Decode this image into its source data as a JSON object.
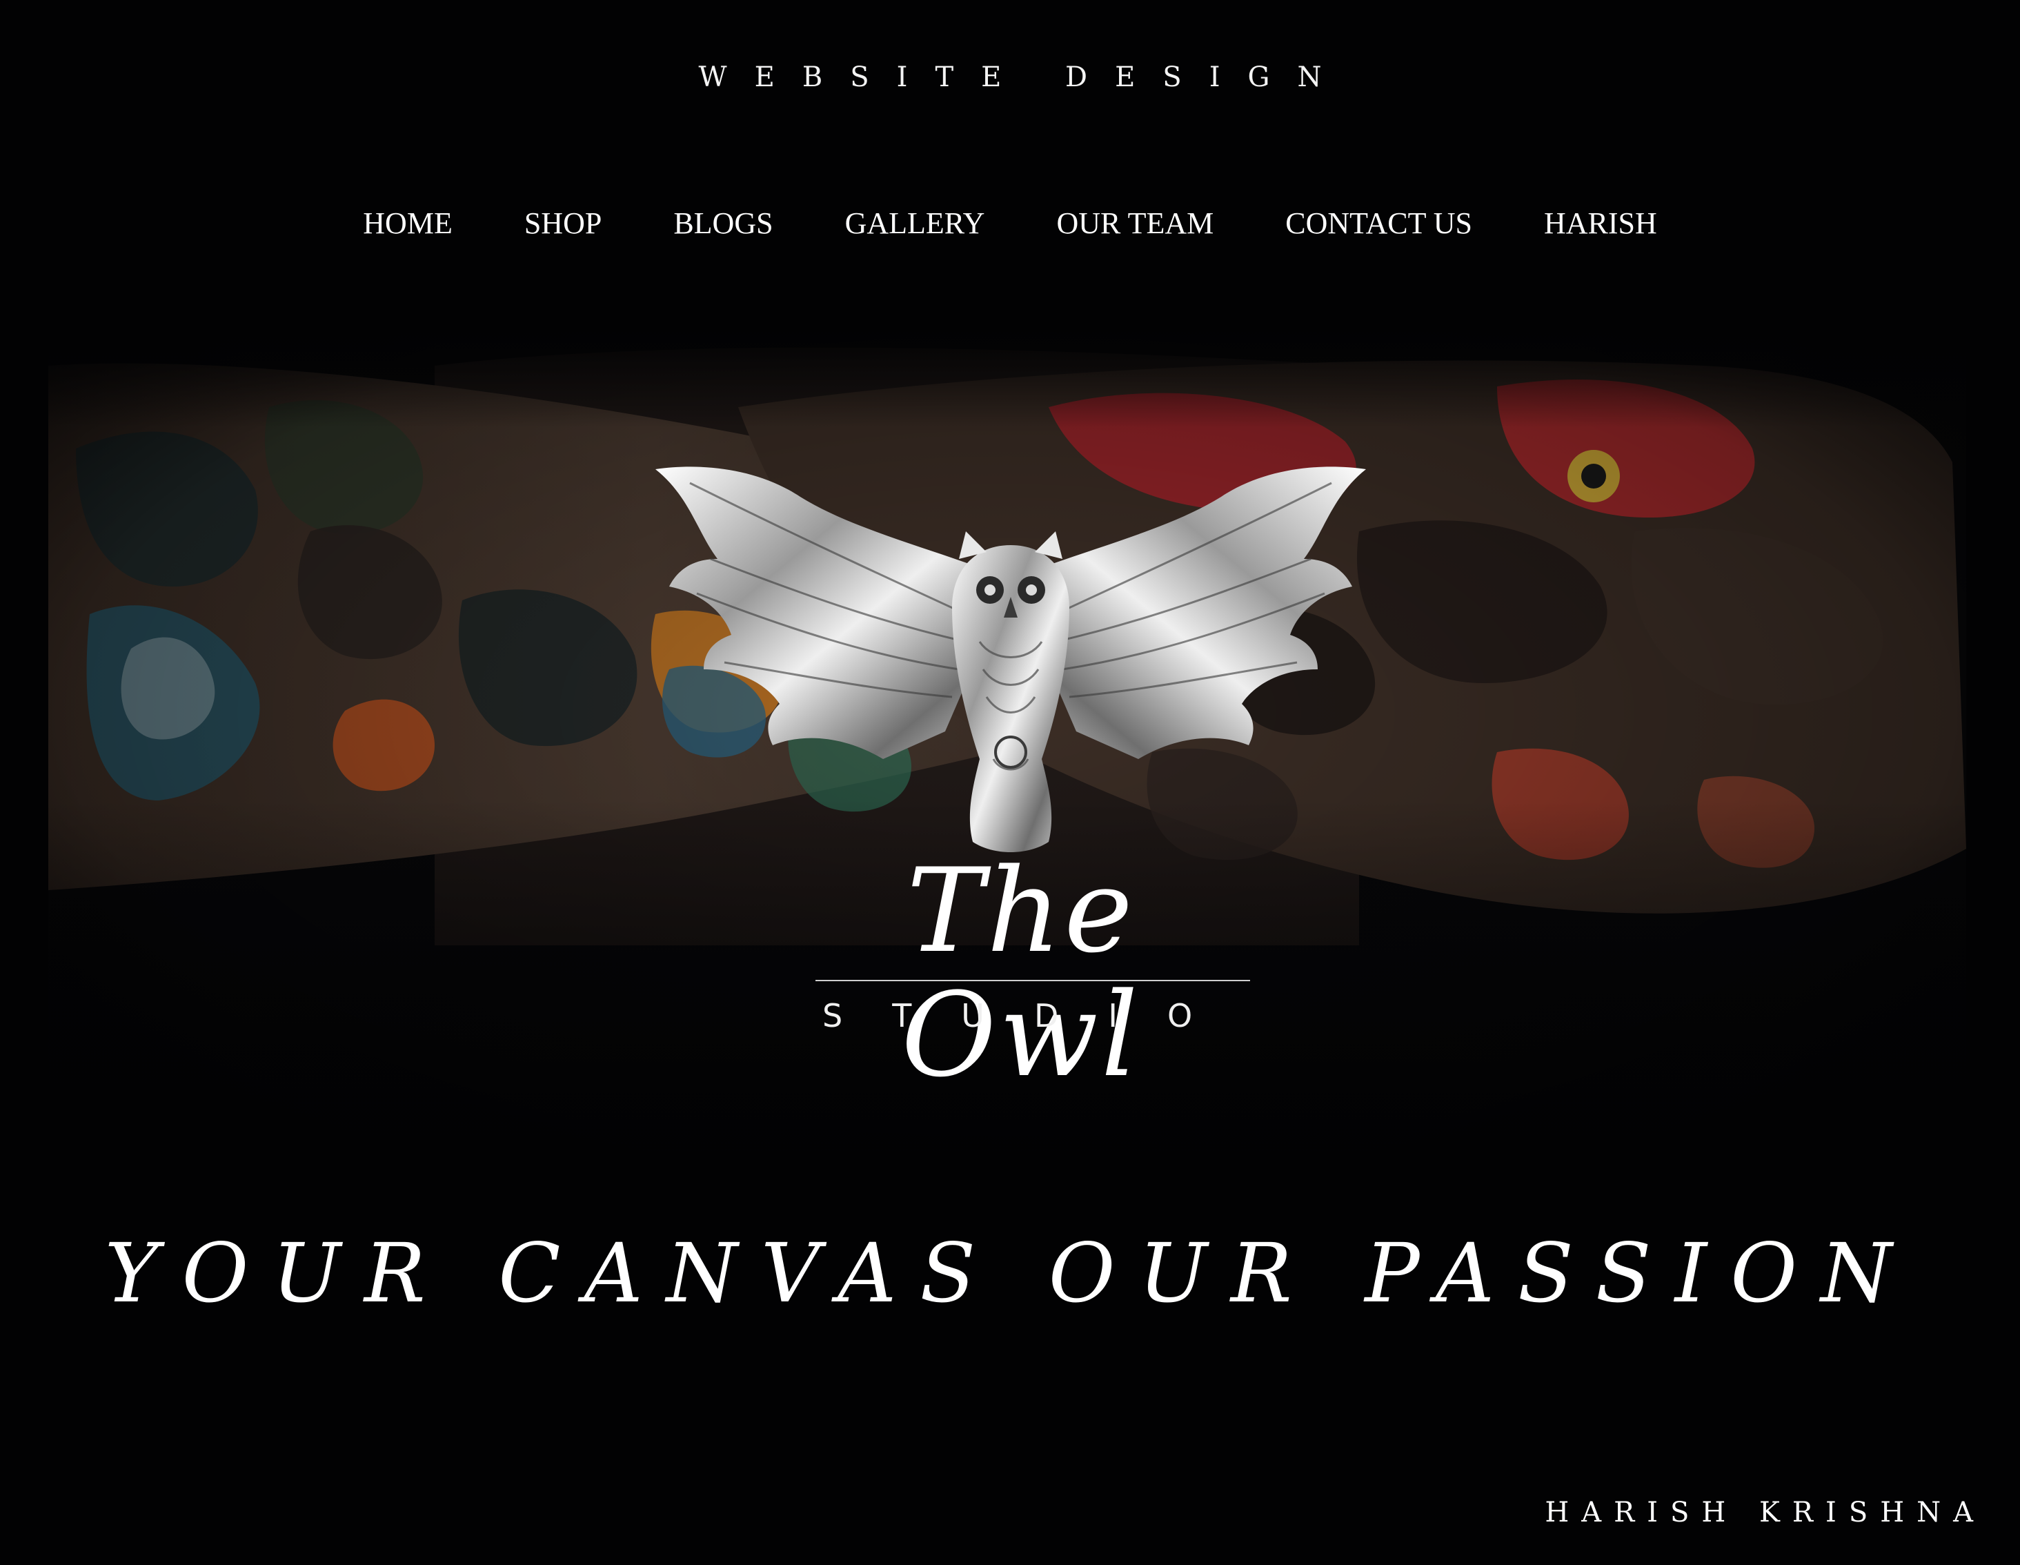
{
  "header": {
    "label": "WEBSITE DESIGN"
  },
  "nav": {
    "items": [
      {
        "label": "HOME"
      },
      {
        "label": "SHOP"
      },
      {
        "label": "BLOGS"
      },
      {
        "label": "GALLERY"
      },
      {
        "label": "OUR TEAM"
      },
      {
        "label": "CONTACT US"
      },
      {
        "label": "HARISH"
      }
    ]
  },
  "hero": {
    "image": "tattooed-arms-photo",
    "logo_icon": "owl-icon"
  },
  "brand": {
    "title": "The Owl",
    "subtitle": "STUDIO"
  },
  "tagline": "YOUR CANVAS OUR PASSION",
  "footer": {
    "author": "HARISH KRISHNA"
  },
  "colors": {
    "background": "#020203",
    "text": "#ffffff",
    "tattoo_red": "#b3282a",
    "tattoo_teal": "#2a6f86",
    "tattoo_orange": "#d07a23"
  }
}
